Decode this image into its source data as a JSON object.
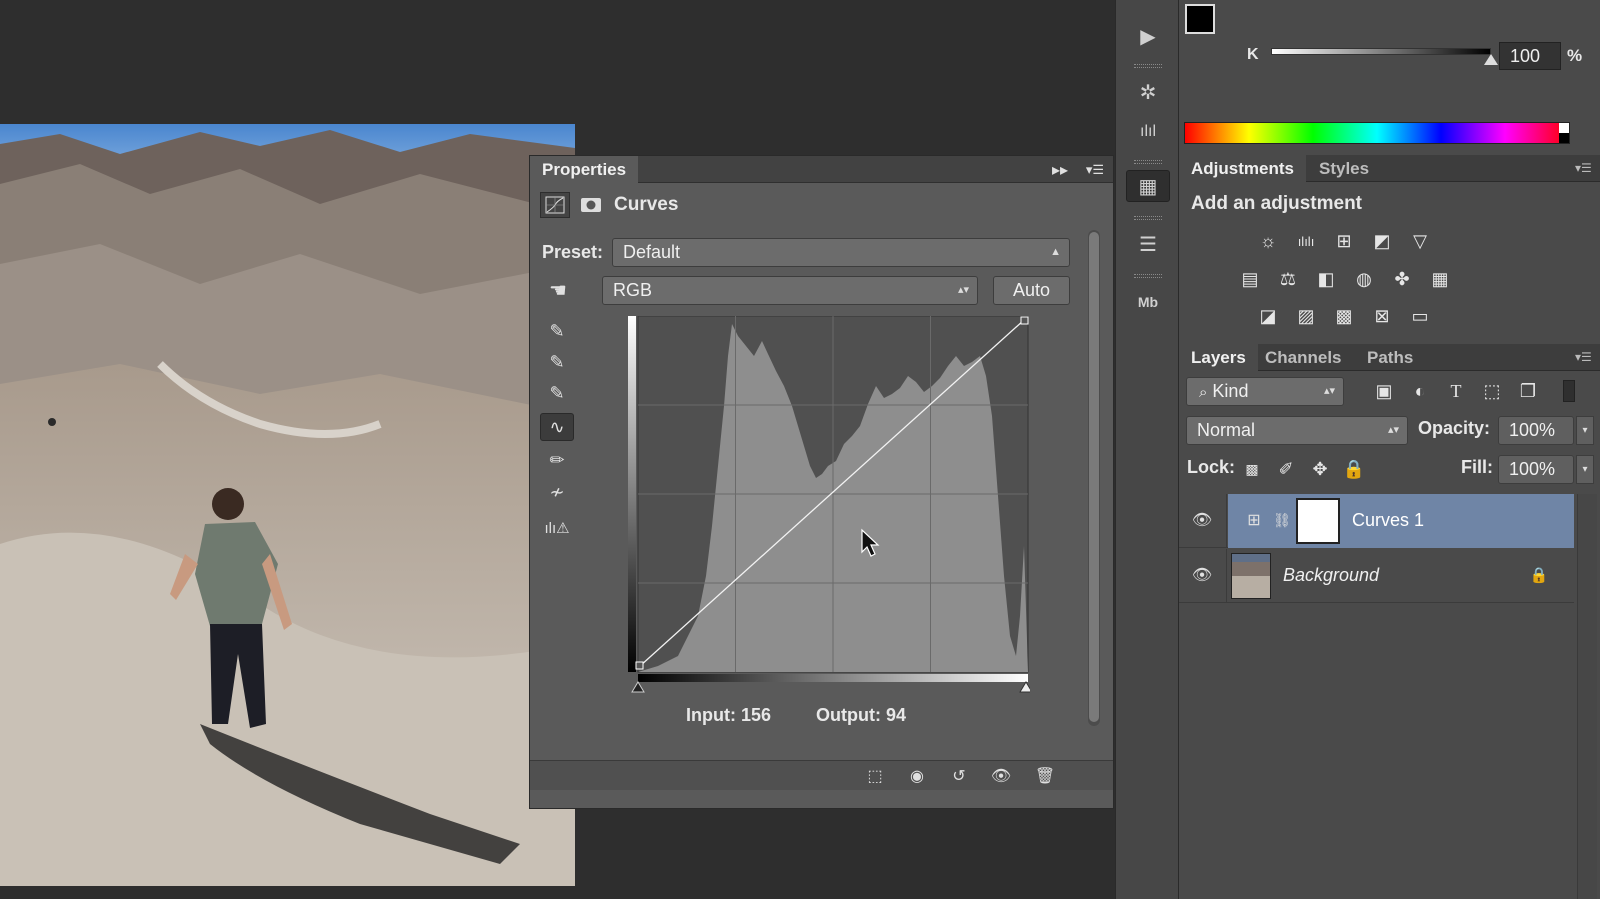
{
  "color_panel": {
    "channel_label": "K",
    "value": "100",
    "unit": "%",
    "slider_level": 1.0
  },
  "properties": {
    "tab": "Properties",
    "title": "Curves",
    "preset_label": "Preset:",
    "preset_value": "Default",
    "channel_value": "RGB",
    "auto_label": "Auto",
    "input_text": "Input: 156",
    "output_text": "Output: 94"
  },
  "adjustments": {
    "tabs": [
      "Adjustments",
      "Styles"
    ],
    "heading": "Add an adjustment"
  },
  "layers": {
    "tabs": [
      "Layers",
      "Channels",
      "Paths"
    ],
    "filter_value": "Kind",
    "blend_mode": "Normal",
    "opacity_label": "Opacity:",
    "opacity_value": "100%",
    "lock_label": "Lock:",
    "fill_label": "Fill:",
    "fill_value": "100%",
    "items": [
      {
        "name": "Curves 1",
        "selected": true
      },
      {
        "name": "Background",
        "selected": false
      }
    ]
  },
  "colors": {
    "selection": "#6f85a6",
    "panel": "#5a5a5a",
    "dark": "#2e2e2e"
  }
}
